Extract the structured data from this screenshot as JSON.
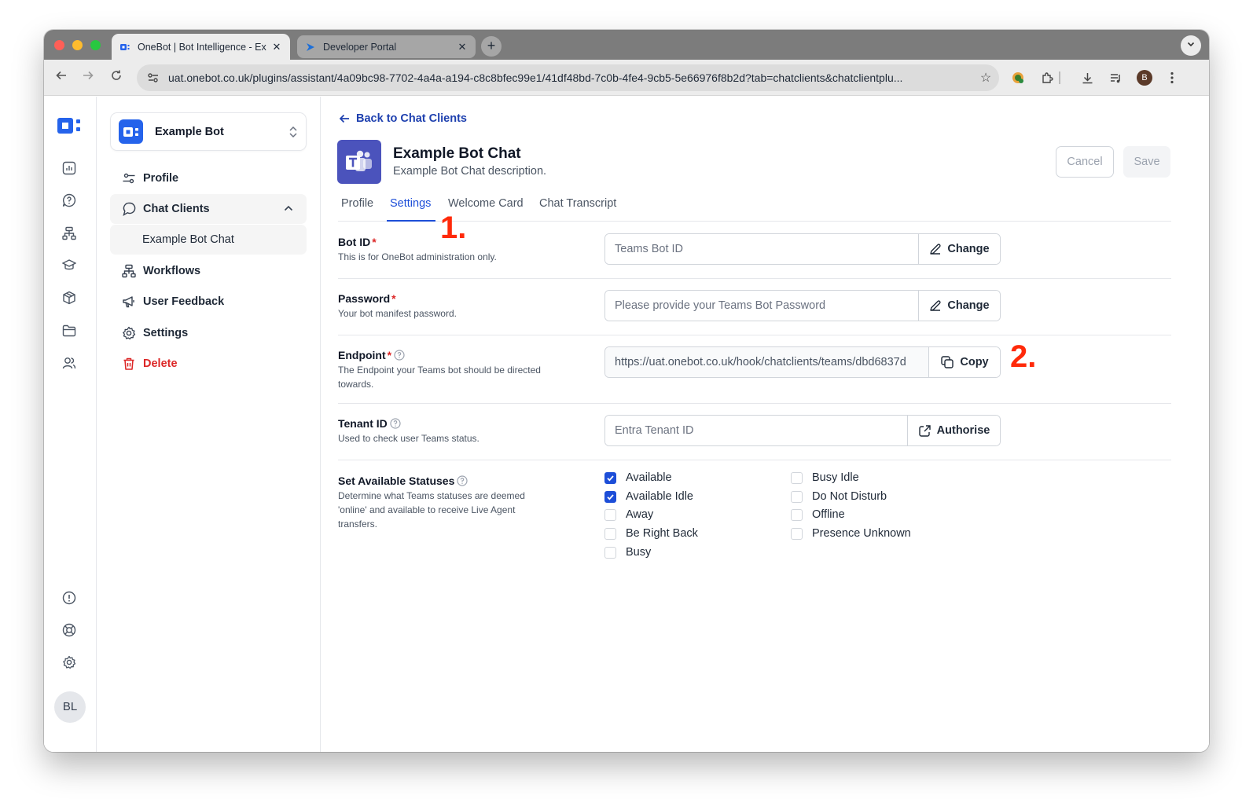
{
  "browser": {
    "tabs": [
      {
        "title": "OneBot | Bot Intelligence - Ex",
        "close": "✕"
      },
      {
        "title": "Developer Portal",
        "close": "✕"
      }
    ],
    "new_tab": "+",
    "url": "uat.onebot.co.uk/plugins/assistant/4a09bc98-7702-4a4a-a194-c8c8bfec99e1/41df48bd-7c0b-4fe4-9cb5-5e66976f8b2d?tab=chatclients&chatclientplu...",
    "profile_initial": "B"
  },
  "rail": {
    "icons": [
      "analytics-icon",
      "help-chat-icon",
      "workflow-icon",
      "knowledge-icon",
      "package-icon",
      "folder-icon",
      "users-icon"
    ],
    "bottom_icons": [
      "alert-icon",
      "support-icon",
      "settings-icon"
    ],
    "user_initials": "BL"
  },
  "sidebar": {
    "bot_name": "Example Bot",
    "items": [
      {
        "label": "Profile",
        "icon": "sliders-icon"
      },
      {
        "label": "Chat Clients",
        "icon": "chat-icon",
        "expanded": true
      },
      {
        "label": "Example Bot Chat",
        "sub": true
      },
      {
        "label": "Workflows",
        "icon": "workflow-icon"
      },
      {
        "label": "User Feedback",
        "icon": "megaphone-icon"
      },
      {
        "label": "Settings",
        "icon": "gear-icon"
      },
      {
        "label": "Delete",
        "icon": "trash-icon",
        "danger": true
      }
    ]
  },
  "main": {
    "back_label": "Back to Chat Clients",
    "chat_title": "Example Bot Chat",
    "chat_description": "Example Bot Chat description.",
    "cancel_label": "Cancel",
    "save_label": "Save",
    "tabs": [
      "Profile",
      "Settings",
      "Welcome Card",
      "Chat Transcript"
    ],
    "active_tab": "Settings",
    "fields": {
      "bot_id": {
        "label": "Bot ID",
        "required": "*",
        "description": "This is for OneBot administration only.",
        "placeholder": "Teams Bot ID",
        "button": "Change"
      },
      "password": {
        "label": "Password",
        "required": "*",
        "description": "Your bot manifest password.",
        "placeholder": "Please provide your Teams Bot Password",
        "button": "Change"
      },
      "endpoint": {
        "label": "Endpoint",
        "required": "*",
        "description": "The Endpoint your Teams bot should be directed towards.",
        "value": "https://uat.onebot.co.uk/hook/chatclients/teams/dbd6837d",
        "button": "Copy"
      },
      "tenant_id": {
        "label": "Tenant ID",
        "description": "Used to check user Teams status.",
        "placeholder": "Entra Tenant ID",
        "button": "Authorise"
      },
      "statuses": {
        "label": "Set Available Statuses",
        "description": "Determine what Teams statuses are deemed 'online' and available to receive Live Agent transfers.",
        "options_col1": [
          {
            "label": "Available",
            "checked": true
          },
          {
            "label": "Available Idle",
            "checked": true
          },
          {
            "label": "Away",
            "checked": false
          },
          {
            "label": "Be Right Back",
            "checked": false
          },
          {
            "label": "Busy",
            "checked": false
          }
        ],
        "options_col2": [
          {
            "label": "Busy Idle",
            "checked": false
          },
          {
            "label": "Do Not Disturb",
            "checked": false
          },
          {
            "label": "Offline",
            "checked": false
          },
          {
            "label": "Presence Unknown",
            "checked": false
          }
        ]
      }
    },
    "annotations": [
      "1.",
      "2."
    ]
  },
  "colors": {
    "accent": "#1d4ed8",
    "danger": "#dc2626",
    "annotation": "#ff2a0a",
    "teams": "#4b53bc"
  }
}
